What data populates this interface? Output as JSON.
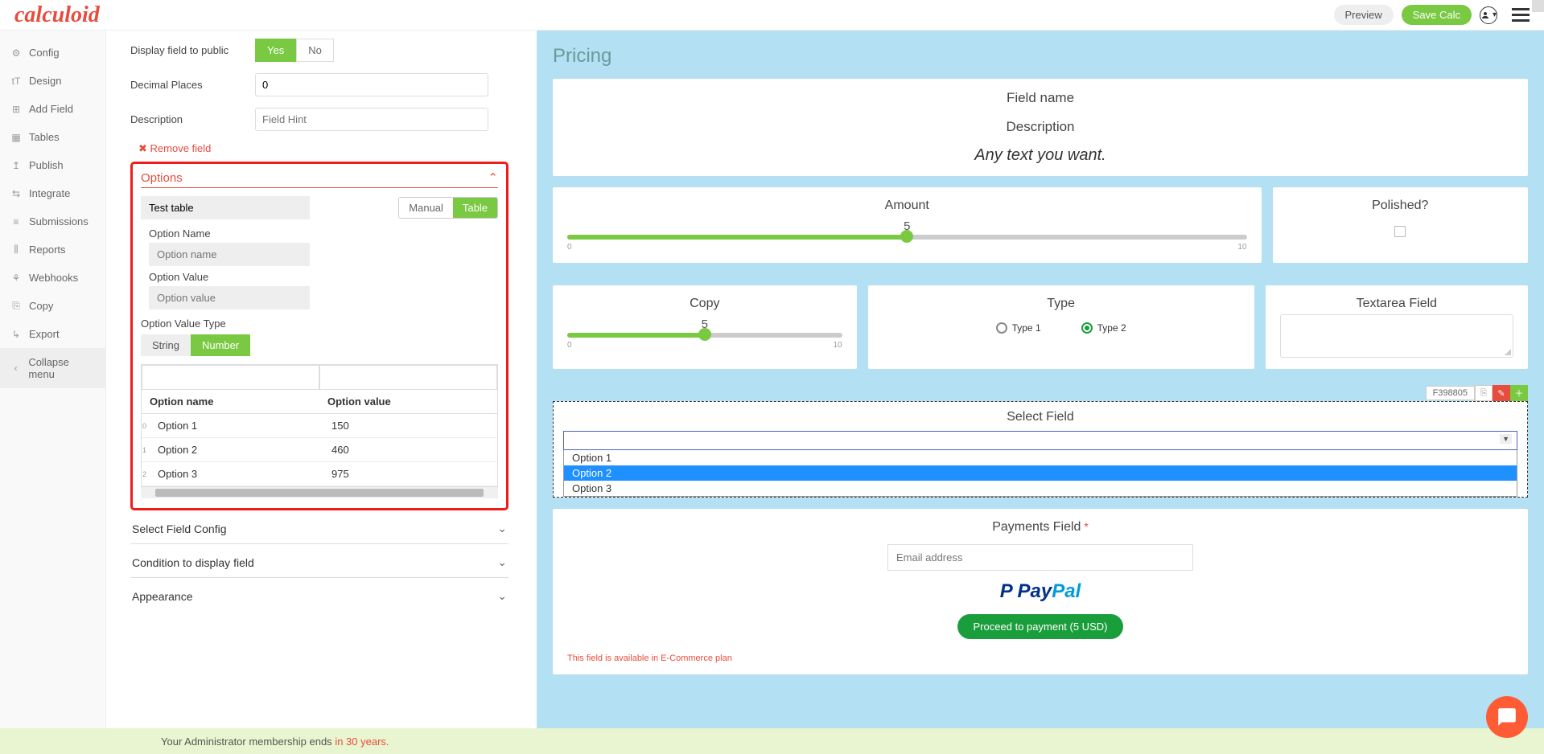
{
  "header": {
    "logo": "calculoid",
    "preview": "Preview",
    "save": "Save Calc"
  },
  "sidebar": {
    "items": [
      {
        "icon": "⚙",
        "label": "Config"
      },
      {
        "icon": "tT",
        "label": "Design"
      },
      {
        "icon": "⊞",
        "label": "Add Field"
      },
      {
        "icon": "▦",
        "label": "Tables"
      },
      {
        "icon": "↥",
        "label": "Publish"
      },
      {
        "icon": "⇆",
        "label": "Integrate"
      },
      {
        "icon": "≡",
        "label": "Submissions"
      },
      {
        "icon": "⫼",
        "label": "Reports"
      },
      {
        "icon": "⚘",
        "label": "Webhooks"
      },
      {
        "icon": "⎘",
        "label": "Copy"
      },
      {
        "icon": "↳",
        "label": "Export"
      }
    ],
    "collapse": "Collapse menu"
  },
  "editor": {
    "display_label": "Display field to public",
    "yes": "Yes",
    "no": "No",
    "decimal_label": "Decimal Places",
    "decimal_value": "0",
    "desc_label": "Description",
    "desc_placeholder": "Field Hint",
    "remove": "Remove field",
    "options_title": "Options",
    "test_table": "Test table",
    "manual": "Manual",
    "table": "Table",
    "option_name_label": "Option Name",
    "option_name_ph": "Option name",
    "option_value_label": "Option Value",
    "option_value_ph": "Option value",
    "ovt_label": "Option Value Type",
    "string": "String",
    "number": "Number",
    "col_name": "Option name",
    "col_value": "Option value",
    "rows": [
      {
        "idx": "0",
        "name": "Option 1",
        "value": "150"
      },
      {
        "idx": "1",
        "name": "Option 2",
        "value": "460"
      },
      {
        "idx": "2",
        "name": "Option 3",
        "value": "975"
      }
    ],
    "sec1": "Select Field Config",
    "sec2": "Condition to display field",
    "sec3": "Appearance"
  },
  "preview": {
    "title": "Pricing",
    "field_name": "Field name",
    "description": "Description",
    "anytext": "Any text you want.",
    "amount": "Amount",
    "amount_val": "5",
    "amount_min": "0",
    "amount_max": "10",
    "polished": "Polished?",
    "copy": "Copy",
    "copy_val": "5",
    "copy_min": "0",
    "copy_max": "10",
    "type": "Type",
    "type1": "Type 1",
    "type2": "Type 2",
    "textarea": "Textarea Field",
    "field_id": "F398805",
    "select_label": "Select Field",
    "dd_options": [
      "Option 1",
      "Option 2",
      "Option 3"
    ],
    "payments": "Payments Field",
    "email_ph": "Email address",
    "proceed": "Proceed to payment (5 USD)",
    "ecom_note": "This field is available in E-Commerce plan"
  },
  "footer": {
    "text_a": "Your Administrator membership ends ",
    "text_b": "in 30 years."
  }
}
